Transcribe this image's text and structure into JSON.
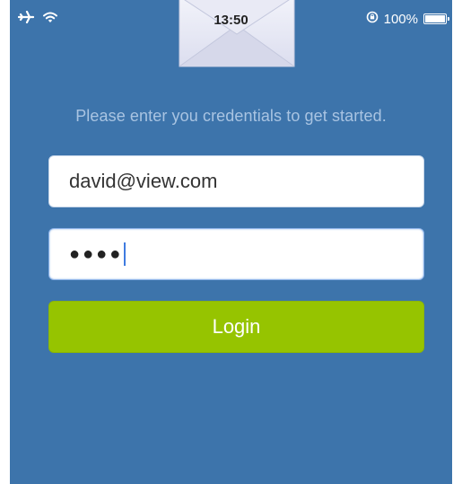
{
  "status_bar": {
    "time": "13:50",
    "battery_text": "100%",
    "battery_level": 1.0,
    "icons": [
      "airplane-icon",
      "wifi-icon",
      "rotation-lock-icon",
      "battery-icon"
    ]
  },
  "login": {
    "prompt": "Please enter you credentials to get started.",
    "email_value": "david@view.com",
    "password_mask": "●●●●",
    "button_label": "Login"
  },
  "colors": {
    "background": "#3d74ab",
    "button": "#96c400",
    "prompt_text": "#a9c4e2"
  }
}
